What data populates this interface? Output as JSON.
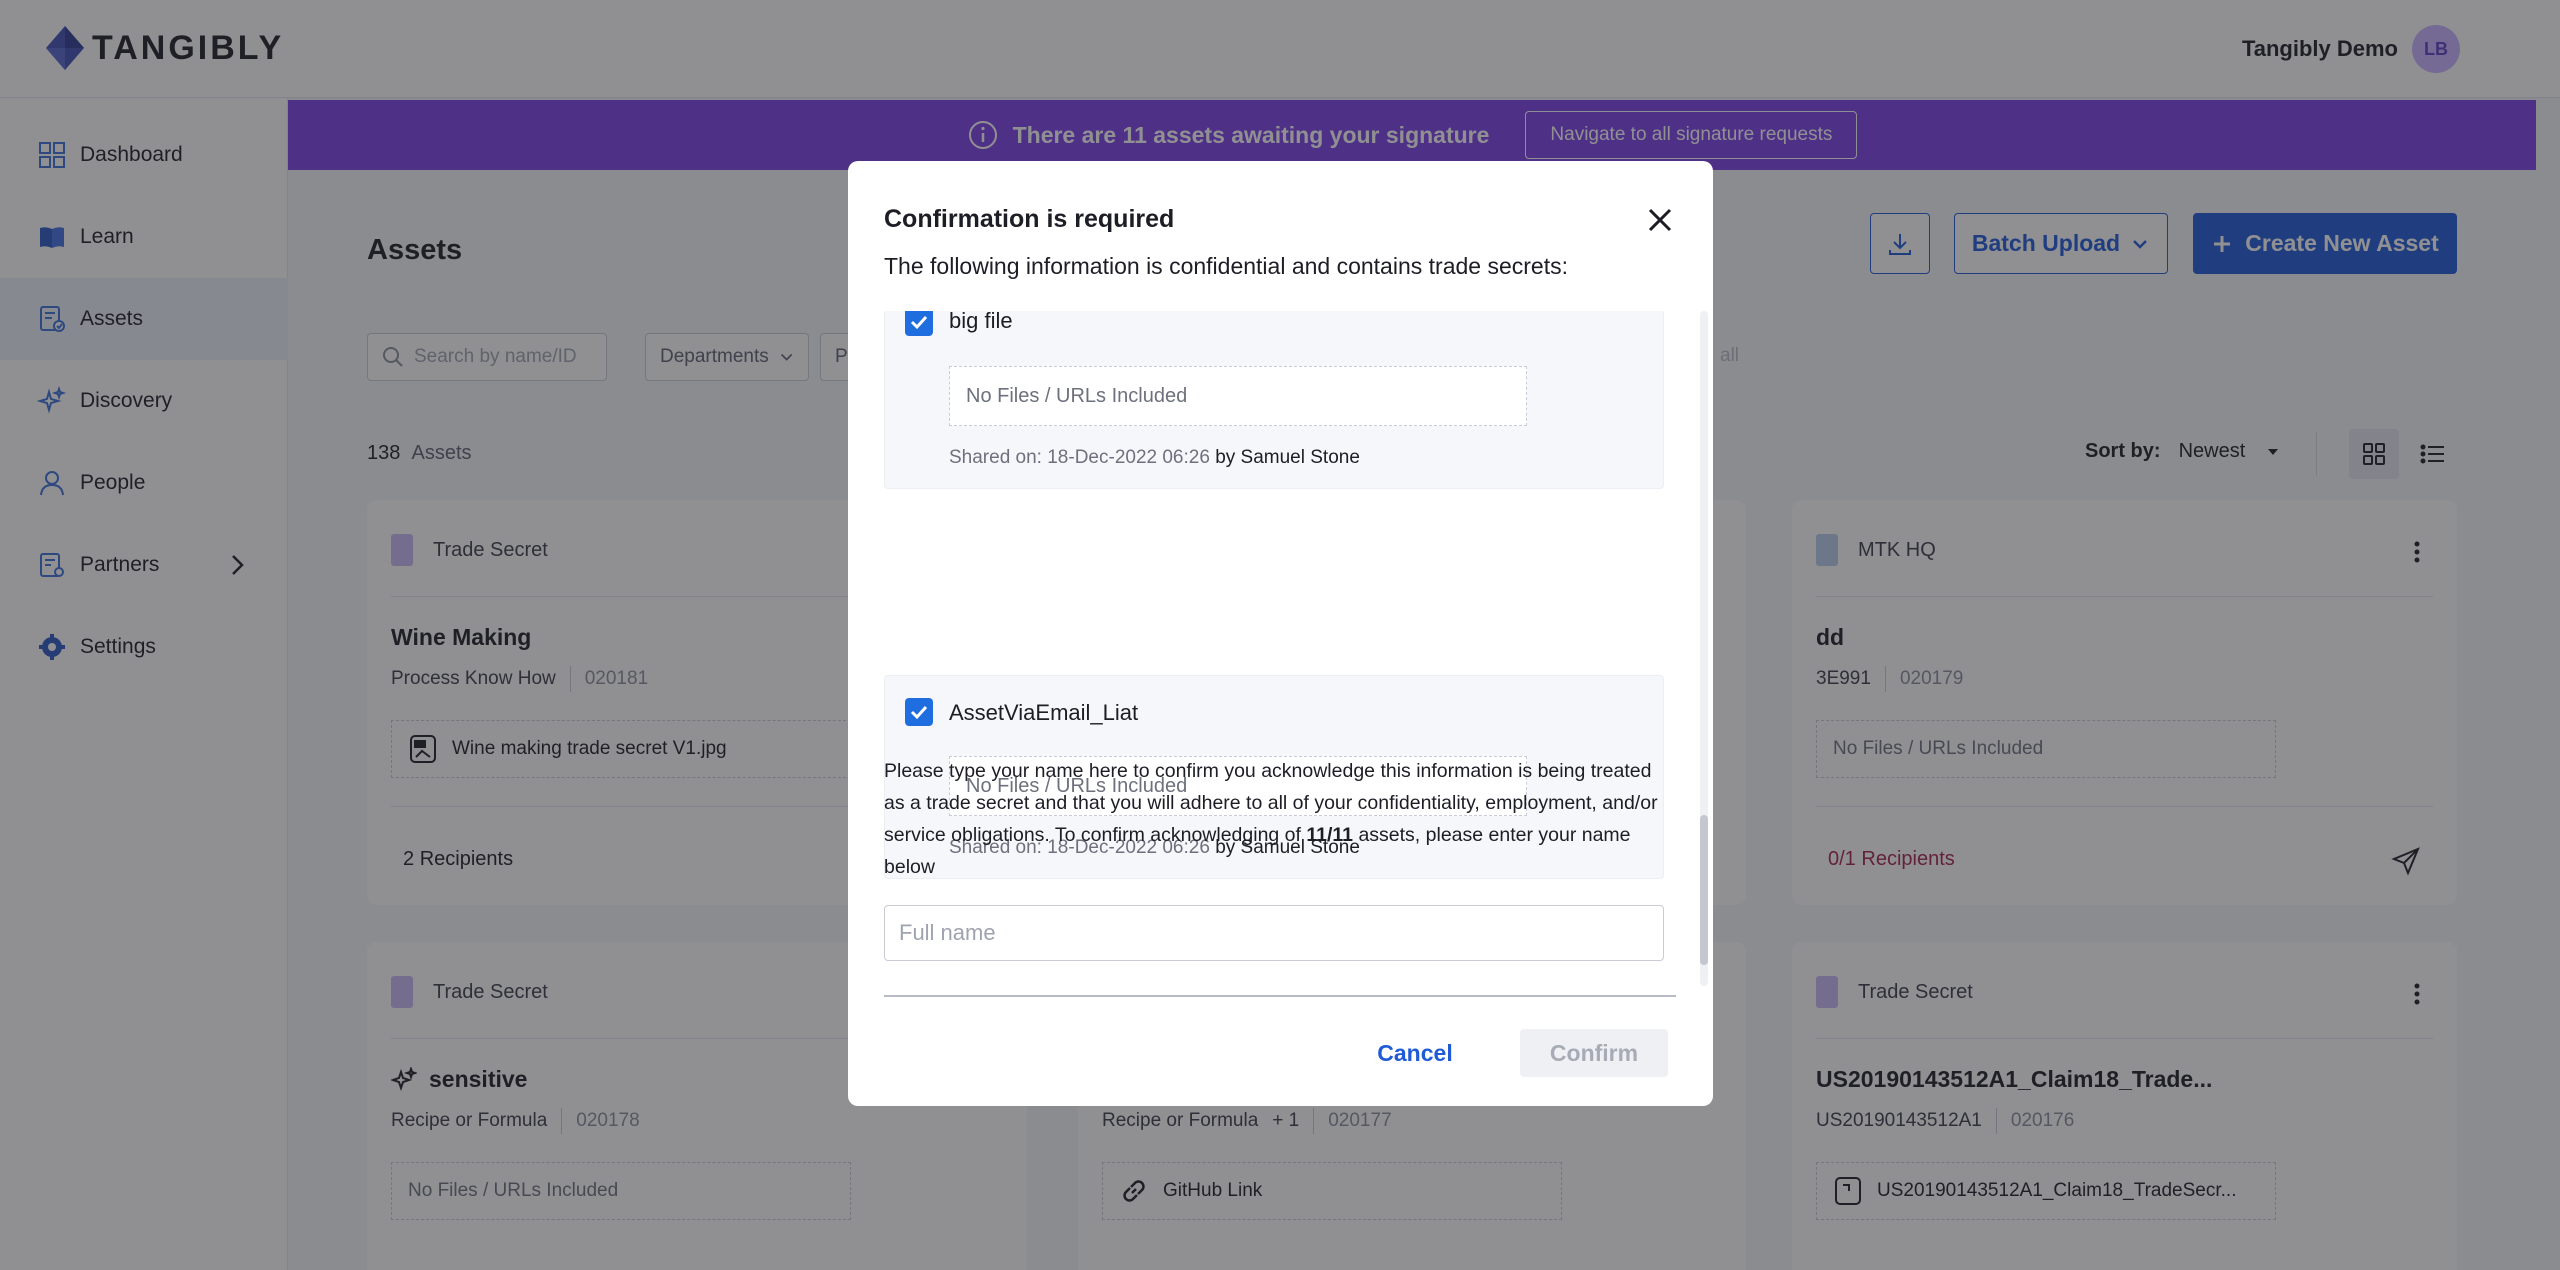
{
  "header": {
    "logo_text": "TANGIBLY",
    "user_name": "Tangibly Demo",
    "avatar_initials": "LB"
  },
  "sidebar": {
    "items": [
      {
        "label": "Dashboard",
        "icon": "dashboard-icon"
      },
      {
        "label": "Learn",
        "icon": "book-icon"
      },
      {
        "label": "Assets",
        "icon": "assets-icon",
        "active": true
      },
      {
        "label": "Discovery",
        "icon": "sparkle-icon"
      },
      {
        "label": "People",
        "icon": "person-icon"
      },
      {
        "label": "Partners",
        "icon": "partners-icon"
      },
      {
        "label": "Settings",
        "icon": "gear-icon"
      }
    ]
  },
  "banner": {
    "message": "There are 11 assets awaiting your signature",
    "button_label": "Navigate to all signature requests"
  },
  "main": {
    "title": "Assets",
    "batch_upload_label": "Batch Upload",
    "create_label": "Create New Asset",
    "search_placeholder": "Search by name/ID",
    "filters": [
      "Departments",
      "P"
    ],
    "filter_link": "all",
    "count": "138",
    "count_label": "Assets",
    "sort_label": "Sort by:",
    "sort_value": "Newest"
  },
  "cards": [
    {
      "tag": "Trade Secret",
      "tag_color": "#c6b8f2",
      "title": "Wine Making",
      "meta": "Process Know How",
      "id": "020181",
      "file": "Wine making trade secret V1.jpg",
      "recipients": "2",
      "recipients_label": "Recipients"
    },
    {
      "tag": "MTK HQ",
      "tag_color": "#b7ccea",
      "title": "dd",
      "meta": "3E991",
      "id": "020179",
      "file": "No Files / URLs Included",
      "recipients": "0/1",
      "recipients_label": "Recipients"
    },
    {
      "tag": "Trade Secret",
      "tag_color": "#c6b8f2",
      "title": "sensitive",
      "meta": "Recipe or Formula",
      "id": "020178",
      "file": "No Files / URLs Included"
    },
    {
      "meta": "Recipe or Formula",
      "meta_extra": "+ 1",
      "id": "020177",
      "file": "GitHub Link"
    },
    {
      "tag": "Trade Secret",
      "tag_color": "#c6b8f2",
      "title": "US20190143512A1_Claim18_Trade...",
      "meta": "US20190143512A1",
      "id": "020176",
      "file": "US20190143512A1_Claim18_TradeSecr..."
    }
  ],
  "modal": {
    "title": "Confirmation is required",
    "subtitle": "The following information is confidential and contains trade secrets:",
    "items": [
      {
        "name": "big file",
        "files": "No Files / URLs Included",
        "shared_on": "Shared on: 18-Dec-2022 06:26",
        "by": "by Samuel Stone"
      },
      {
        "name": "AssetViaEmail_Liat",
        "files": "No Files / URLs Included",
        "shared_on": "Shared on: 18-Dec-2022 06:26",
        "by": "by Samuel Stone"
      }
    ],
    "ack_text_before": "Please type your name here to confirm you acknowledge this information is being treated as a trade secret and that you will adhere to all of your confidentiality, employment, and/or service obligations. To confirm acknowledging of ",
    "ack_count": "11/11",
    "ack_text_after": " assets, please enter your name below",
    "name_placeholder": "Full name",
    "cancel_label": "Cancel",
    "confirm_label": "Confirm"
  }
}
